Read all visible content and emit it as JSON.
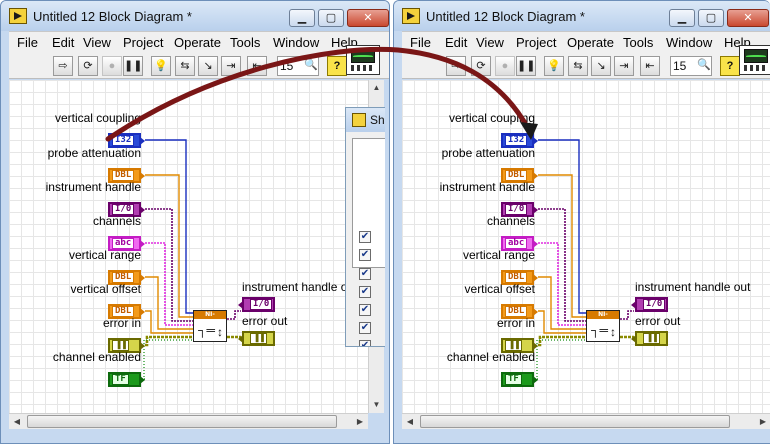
{
  "windows": [
    {
      "id": "left",
      "title": "Untitled 12 Block Diagram *",
      "menu": [
        "File",
        "Edit",
        "View",
        "Project",
        "Operate",
        "Tools",
        "Window",
        "Help"
      ],
      "toolbar": {
        "font_size": "15",
        "run_label": "Run",
        "abort_label": "Abort",
        "pause_label": "Pause"
      },
      "diagram": {
        "inputs": [
          {
            "label": "vertical coupling",
            "type": "I32"
          },
          {
            "label": "probe attenuation",
            "type": "DBL"
          },
          {
            "label": "instrument handle",
            "type": "I/0"
          },
          {
            "label": "channels",
            "type": "abc"
          },
          {
            "label": "vertical range",
            "type": "DBL"
          },
          {
            "label": "vertical offset",
            "type": "DBL"
          },
          {
            "label": "error in",
            "type": "▐▐"
          },
          {
            "label": "channel enabled",
            "type": "TF"
          }
        ],
        "outputs": [
          {
            "label": "instrument handle out",
            "type": "I/0"
          },
          {
            "label": "error out",
            "type": "▐▐"
          }
        ],
        "subvi": {
          "band": "NI-SCOPE",
          "glyph": "┐═",
          "arrow": "↕"
        }
      }
    },
    {
      "id": "right",
      "title": "Untitled 12 Block Diagram *",
      "menu": [
        "File",
        "Edit",
        "View",
        "Project",
        "Operate",
        "Tools",
        "Window",
        "Help"
      ],
      "toolbar": {
        "font_size": "15",
        "run_label": "Run",
        "abort_label": "Abort",
        "pause_label": "Pause"
      },
      "diagram": {
        "inputs": [
          {
            "label": "vertical coupling",
            "type": "I32"
          },
          {
            "label": "probe attenuation",
            "type": "DBL"
          },
          {
            "label": "instrument handle",
            "type": "I/0"
          },
          {
            "label": "channels",
            "type": "abc"
          },
          {
            "label": "vertical range",
            "type": "DBL"
          },
          {
            "label": "vertical offset",
            "type": "DBL"
          },
          {
            "label": "error in",
            "type": "▐▐"
          },
          {
            "label": "channel enabled",
            "type": "TF"
          }
        ],
        "outputs": [
          {
            "label": "instrument handle out",
            "type": "I/0"
          },
          {
            "label": "error out",
            "type": "▐▐"
          }
        ],
        "subvi": {
          "band": "NI-SCOPE",
          "glyph": "┐═",
          "arrow": "↕"
        }
      }
    }
  ],
  "dialog": {
    "title": "Sh"
  },
  "colors": {
    "i32_wire": "#1a2fbf",
    "dbl_wire": "#e08a00",
    "refnum_wire": "#6a006a",
    "string_wire": "#e02ae0",
    "error_wire": "#8a8a00",
    "bool_wire": "#0d8a0d",
    "drag_arrow": "#7a1616"
  },
  "icons": [
    "vi-app-icon",
    "minimize-icon",
    "maximize-icon",
    "close-icon",
    "run-arrow-icon",
    "run-continuous-icon",
    "abort-icon",
    "pause-icon",
    "highlight-bulb-icon",
    "retain-wire-icon",
    "step-into-icon",
    "step-over-icon",
    "step-out-icon",
    "search-icon",
    "context-help-icon",
    "scope-vi-icon"
  ]
}
